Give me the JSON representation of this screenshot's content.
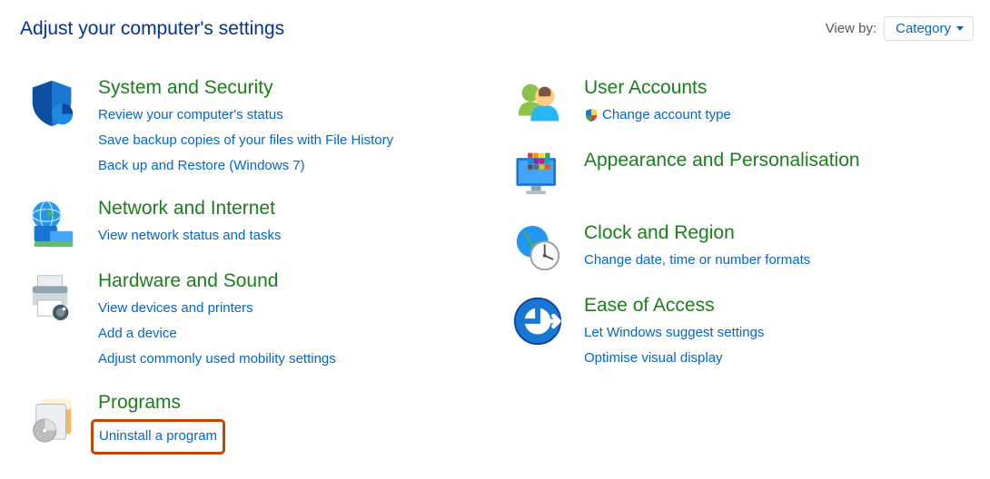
{
  "header": {
    "title": "Adjust your computer's settings",
    "view_by_label": "View by:",
    "view_by_value": "Category"
  },
  "left": [
    {
      "icon": "security-shield",
      "title": "System and Security",
      "links": [
        {
          "label": "Review your computer's status"
        },
        {
          "label": "Save backup copies of your files with File History"
        },
        {
          "label": "Back up and Restore (Windows 7)"
        }
      ]
    },
    {
      "icon": "network-globe",
      "title": "Network and Internet",
      "links": [
        {
          "label": "View network status and tasks"
        }
      ]
    },
    {
      "icon": "hardware-printer",
      "title": "Hardware and Sound",
      "links": [
        {
          "label": "View devices and printers"
        },
        {
          "label": "Add a device"
        },
        {
          "label": "Adjust commonly used mobility settings"
        }
      ]
    },
    {
      "icon": "programs-disc",
      "title": "Programs",
      "links": [
        {
          "label": "Uninstall a program",
          "highlight": true
        }
      ]
    }
  ],
  "right": [
    {
      "icon": "user-accounts",
      "title": "User Accounts",
      "links": [
        {
          "label": "Change account type",
          "shield": true
        }
      ]
    },
    {
      "icon": "appearance-monitor",
      "title": "Appearance and Personalisation",
      "links": []
    },
    {
      "icon": "clock-globe",
      "title": "Clock and Region",
      "links": [
        {
          "label": "Change date, time or number formats"
        }
      ]
    },
    {
      "icon": "ease-of-access",
      "title": "Ease of Access",
      "links": [
        {
          "label": "Let Windows suggest settings"
        },
        {
          "label": "Optimise visual display"
        }
      ]
    }
  ]
}
